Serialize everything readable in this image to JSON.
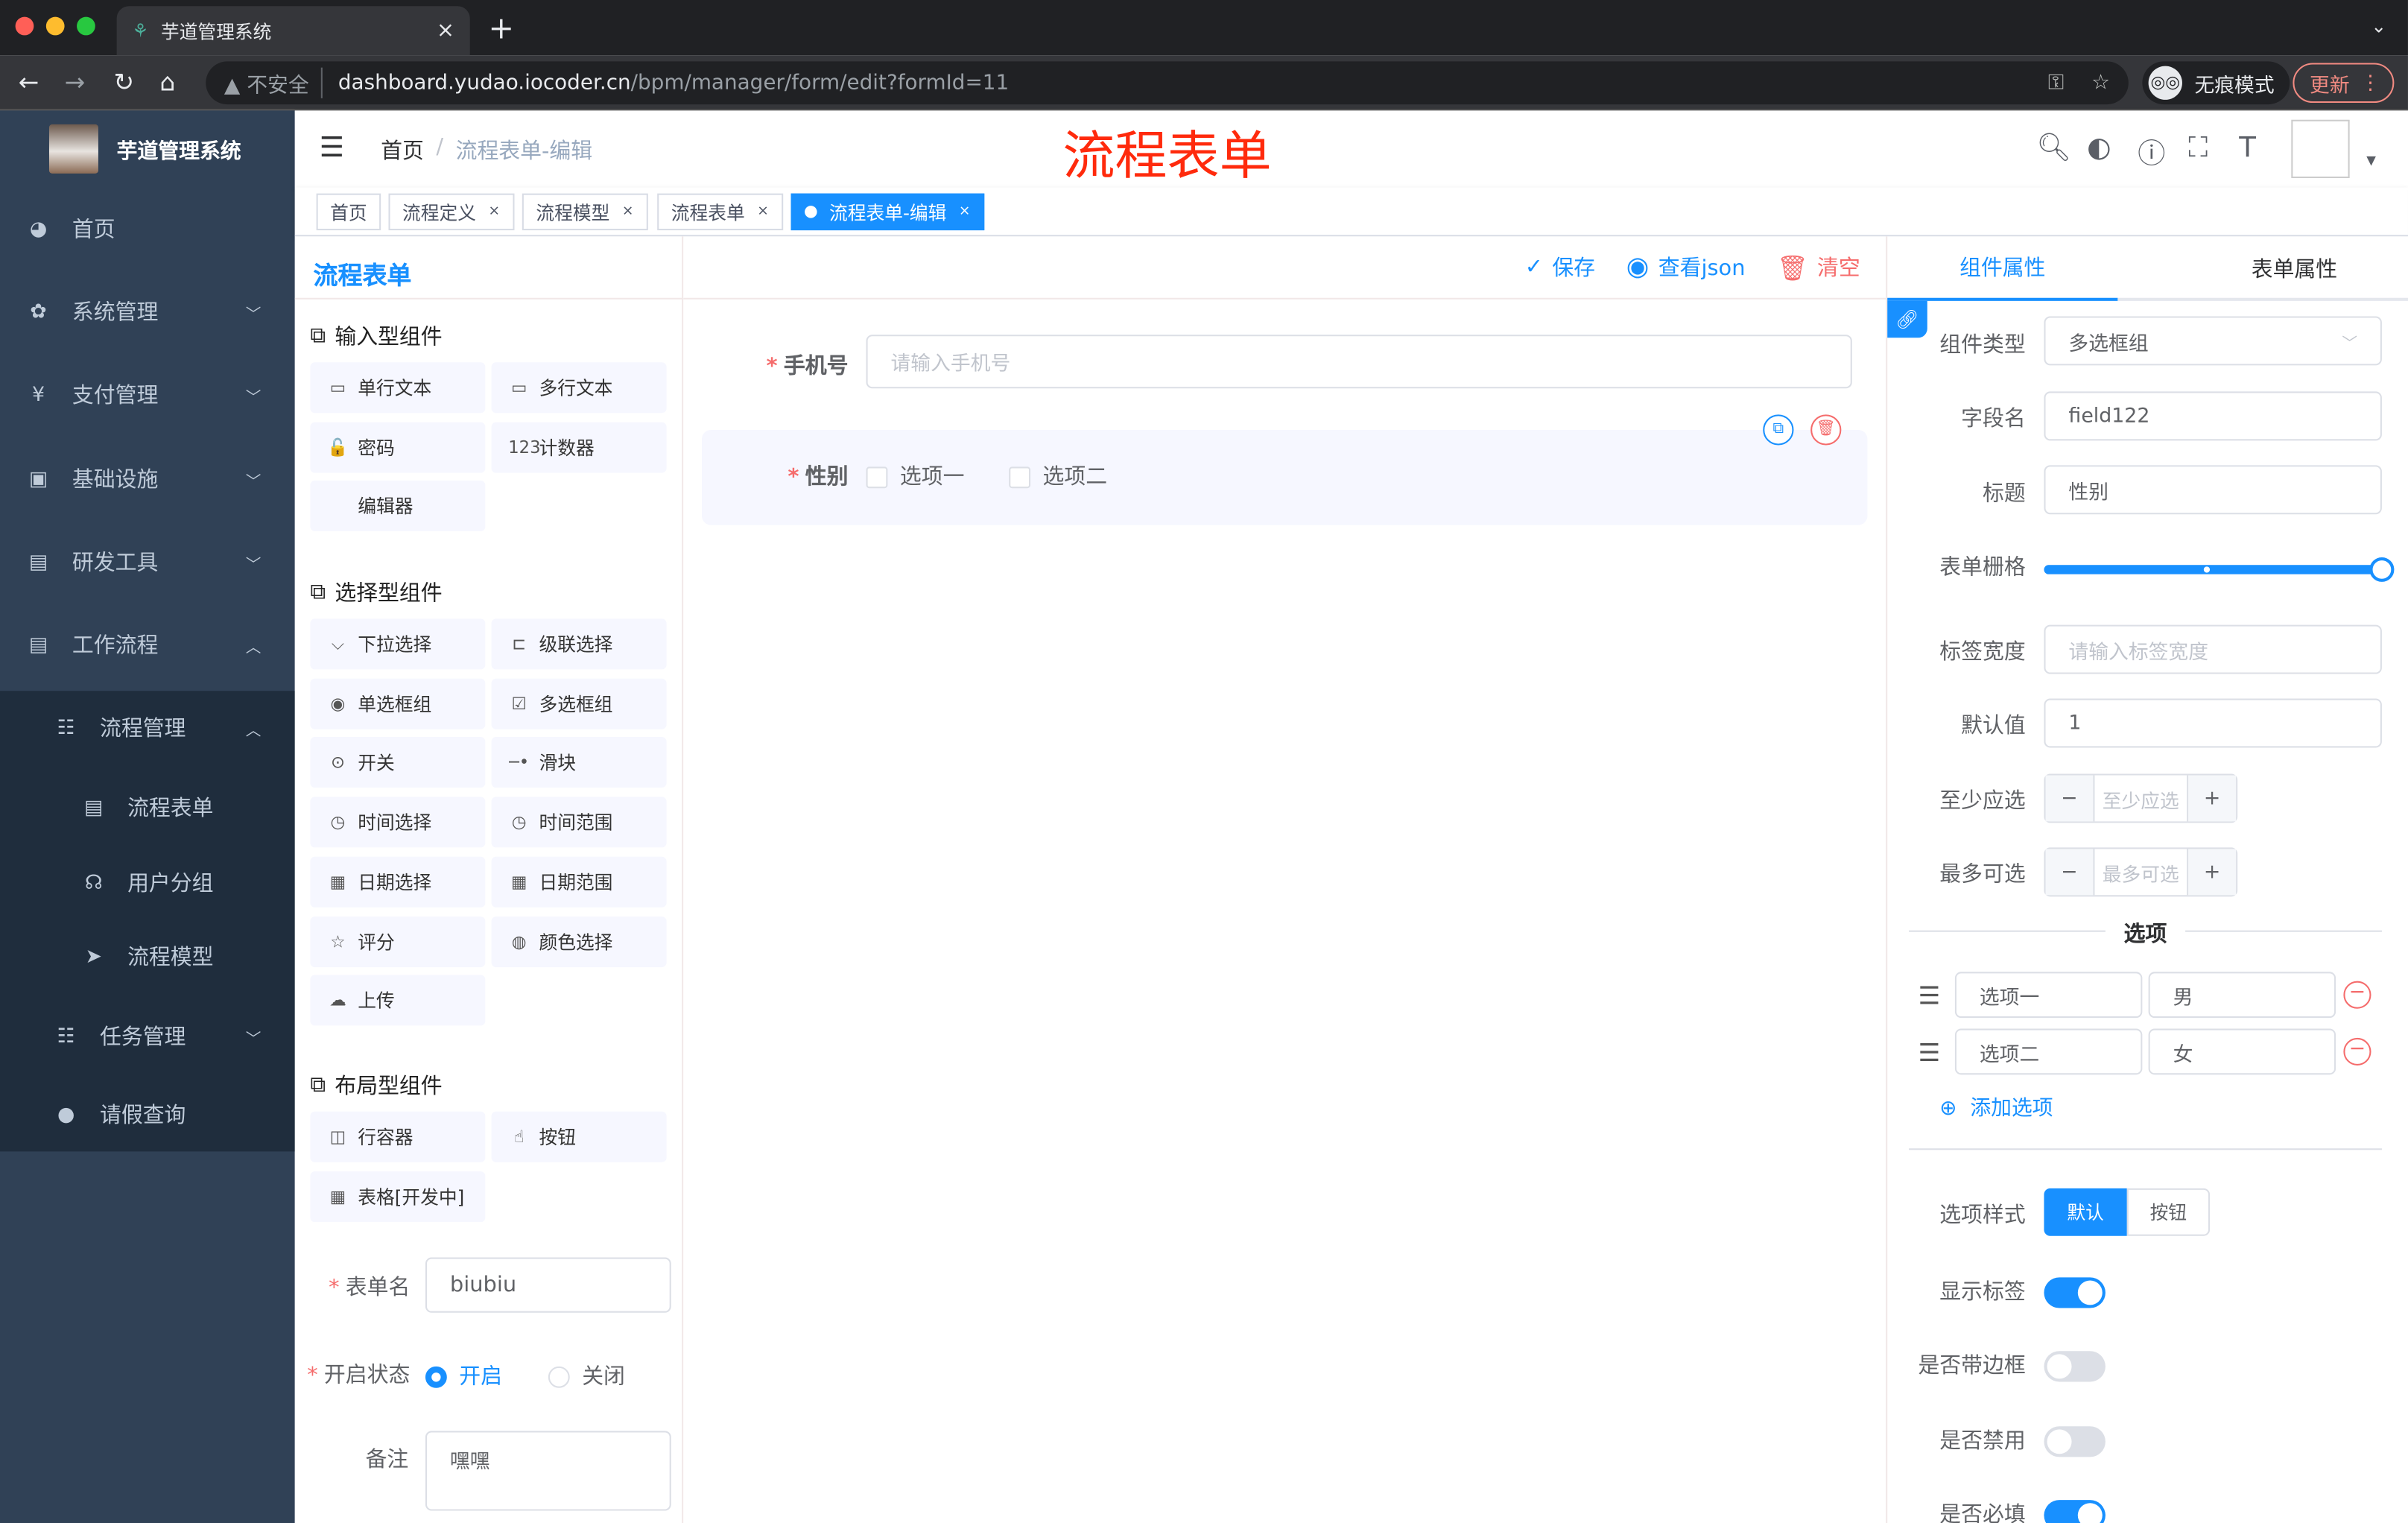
{
  "browser": {
    "tab_title": "芋道管理系统",
    "url_insecure": "不安全",
    "url_host": "dashboard.yudao.iocoder.cn",
    "url_path": "/bpm/manager/form/edit?formId=11",
    "incognito": "无痕模式",
    "update": "更新"
  },
  "colors": {
    "accent": "#1890ff",
    "sidebar": "#304156",
    "submenu": "#1f2d3d",
    "danger": "#f56c6c",
    "annotation": "#ff2a0c"
  },
  "sidebar": {
    "logo_title": "芋道管理系统",
    "items": [
      {
        "label": "首页",
        "icon": "dashboard-icon"
      },
      {
        "label": "系统管理",
        "icon": "gear-icon"
      },
      {
        "label": "支付管理",
        "icon": "yen-icon"
      },
      {
        "label": "基础设施",
        "icon": "monitor-icon"
      },
      {
        "label": "研发工具",
        "icon": "toolbox-icon"
      },
      {
        "label": "工作流程",
        "icon": "toolbox-icon"
      },
      {
        "label": "流程管理",
        "icon": "tree-icon"
      },
      {
        "label": "流程表单",
        "icon": "form-icon"
      },
      {
        "label": "用户分组",
        "icon": "group-icon"
      },
      {
        "label": "流程模型",
        "icon": "send-icon"
      },
      {
        "label": "任务管理",
        "icon": "tree-icon"
      },
      {
        "label": "请假查询",
        "icon": "user-icon"
      }
    ]
  },
  "header": {
    "breadcrumb": [
      "首页",
      "流程表单-编辑"
    ],
    "annotation": "流程表单"
  },
  "tags": [
    "首页",
    "流程定义",
    "流程模型",
    "流程表单",
    "流程表单-编辑"
  ],
  "palette": {
    "title": "流程表单",
    "groups": [
      {
        "title": "输入型组件",
        "items": [
          {
            "label": "单行文本",
            "icon": "▭"
          },
          {
            "label": "多行文本",
            "icon": "▭"
          },
          {
            "label": "密码",
            "icon": "🔓"
          },
          {
            "label": "计数器",
            "icon": "123"
          },
          {
            "label": "编辑器",
            "icon": ""
          }
        ]
      },
      {
        "title": "选择型组件",
        "items": [
          {
            "label": "下拉选择",
            "icon": "⌵"
          },
          {
            "label": "级联选择",
            "icon": "⊏"
          },
          {
            "label": "单选框组",
            "icon": "◉"
          },
          {
            "label": "多选框组",
            "icon": "☑"
          },
          {
            "label": "开关",
            "icon": "⊙"
          },
          {
            "label": "滑块",
            "icon": "─•"
          },
          {
            "label": "时间选择",
            "icon": "◷"
          },
          {
            "label": "时间范围",
            "icon": "◷"
          },
          {
            "label": "日期选择",
            "icon": "▦"
          },
          {
            "label": "日期范围",
            "icon": "▦"
          },
          {
            "label": "评分",
            "icon": "☆"
          },
          {
            "label": "颜色选择",
            "icon": "◍"
          },
          {
            "label": "上传",
            "icon": "☁"
          }
        ]
      },
      {
        "title": "布局型组件",
        "items": [
          {
            "label": "行容器",
            "icon": "◫"
          },
          {
            "label": "按钮",
            "icon": "☝"
          },
          {
            "label": "表格[开发中]",
            "icon": "▦"
          }
        ]
      }
    ],
    "form_name_label": "表单名",
    "form_name": "biubiu",
    "status_label": "开启状态",
    "status_on": "开启",
    "status_off": "关闭",
    "remark_label": "备注",
    "remark": "嘿嘿"
  },
  "toolbar": {
    "save": "保存",
    "view_json": "查看json",
    "clear": "清空"
  },
  "canvas": {
    "phone_label": "手机号",
    "phone_placeholder": "请输入手机号",
    "gender_label": "性别",
    "options": [
      "选项一",
      "选项二"
    ]
  },
  "props": {
    "tabs": [
      "组件属性",
      "表单属性"
    ],
    "component_type_label": "组件类型",
    "component_type": "多选框组",
    "field_label": "字段名",
    "field": "field122",
    "title_label": "标题",
    "title": "性别",
    "grid_label": "表单栅格",
    "grid_value": 24,
    "grid_max": 24,
    "label_width_label": "标签宽度",
    "label_width_placeholder": "请输入标签宽度",
    "default_label": "默认值",
    "default": "1",
    "min_label": "至少应选",
    "min_placeholder": "至少应选",
    "max_label": "最多可选",
    "max_placeholder": "最多可选",
    "options_divider": "选项",
    "options": [
      {
        "label": "选项一",
        "value": "男"
      },
      {
        "label": "选项二",
        "value": "女"
      }
    ],
    "add_option": "添加选项",
    "style_label": "选项样式",
    "style_options": [
      "默认",
      "按钮"
    ],
    "show_label": "显示标签",
    "show_label_on": true,
    "border_label": "是否带边框",
    "border_on": false,
    "disabled_label": "是否禁用",
    "disabled_on": false,
    "required_label": "是否必填",
    "required_on": true
  }
}
